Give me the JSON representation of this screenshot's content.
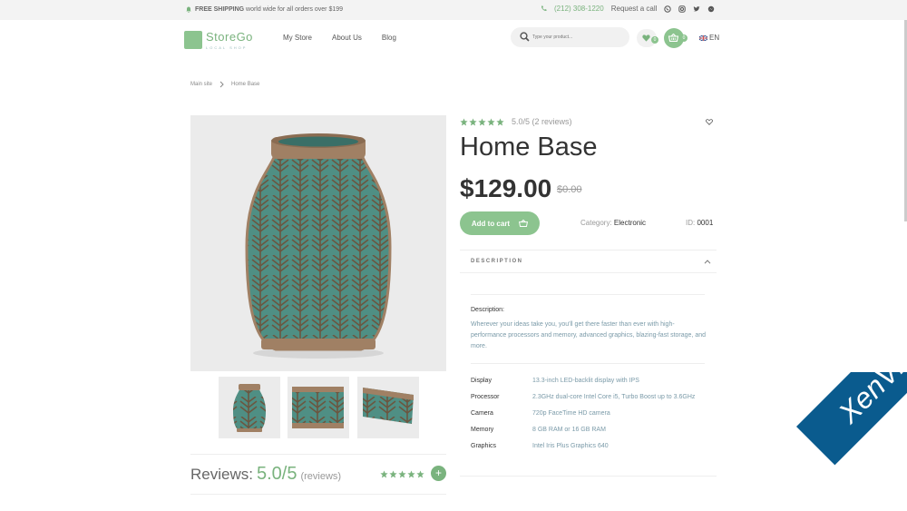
{
  "topbar": {
    "shipping_bold": "FREE SHIPPING",
    "shipping_rest": " world wide for all orders over $199",
    "phone": "(212) 308-1220",
    "request_call": "Request a call"
  },
  "header": {
    "logo_name": "StoreGo",
    "logo_sub": "LOCAL SHOP",
    "nav": [
      "My Store",
      "About Us",
      "Blog"
    ],
    "search_placeholder": "Type your product...",
    "wishlist_count": "0",
    "cart_count": "0",
    "language": "EN"
  },
  "breadcrumb": {
    "root": "Main site",
    "current": "Home Base"
  },
  "product": {
    "rating_text": "5.0/5",
    "reviews_text": "(2 reviews)",
    "rating_stars": 5,
    "title": "Home Base",
    "price": "$129.00",
    "old_price": "$0.00",
    "add_to_cart": "Add to cart",
    "category_label": "Category:",
    "category_value": "Electronic",
    "id_label": "ID:",
    "id_value": "0001",
    "description_tab": "DESCRIPTION",
    "description_title": "Description:",
    "description_text": "Wherever your ideas take you, you'll get there faster than ever with high-performance processors and memory, advanced graphics, blazing-fast storage, and more.",
    "specs": [
      {
        "key": "Display",
        "value": "13.3-inch LED-backlit display with IPS"
      },
      {
        "key": "Processor",
        "value": "2.3GHz dual-core Intel Core i5, Turbo Boost up to 3.6GHz"
      },
      {
        "key": "Camera",
        "value": "720p FaceTime HD camera"
      },
      {
        "key": "Memory",
        "value": "8 GB RAM or 16 GB RAM"
      },
      {
        "key": "Graphics",
        "value": "Intel Iris Plus Graphics 640"
      }
    ]
  },
  "reviews": {
    "label": "Reviews:",
    "score": "5.0/5",
    "sub": "(reviews)"
  },
  "watermark": "XenVn.Com",
  "colors": {
    "accent": "#8cc48f",
    "accent_dark": "#7ab37e",
    "vase_glaze": "#4f8f84",
    "vase_clay": "#a08064"
  }
}
